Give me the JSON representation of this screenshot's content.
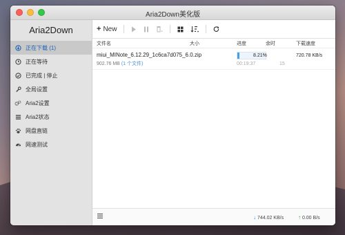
{
  "window": {
    "title": "Aria2Down美化版"
  },
  "sidebar": {
    "brand": "Aria2Down",
    "items": [
      {
        "label": "正在下载 (1)",
        "icon": "download-circle-icon",
        "active": true
      },
      {
        "label": "正在等待",
        "icon": "clock-icon"
      },
      {
        "label": "已完成 | 停止",
        "icon": "check-circle-icon"
      },
      {
        "label": "全局设置",
        "icon": "wrench-icon"
      },
      {
        "label": "Aria2设置",
        "icon": "gears-icon"
      },
      {
        "label": "Aria2状态",
        "icon": "list-icon"
      },
      {
        "label": "网盘直链",
        "icon": "paw-icon"
      },
      {
        "label": "网速测试",
        "icon": "speedometer-icon"
      }
    ]
  },
  "toolbar": {
    "new_label": "New"
  },
  "columns": {
    "name": "文件名",
    "size": "大小",
    "progress": "进度",
    "remaining": "余时",
    "speed": "下载速度"
  },
  "task": {
    "filename": "miui_MINote_6.12.29_1c6ca7d075_6.0.zip",
    "size": "902.76 MB",
    "files": "(1 个文件)",
    "progress_pct": "8.21%",
    "progress_value": 8.21,
    "elapsed": "00:19:37",
    "remaining": "15",
    "speed": "720.78 KB/s"
  },
  "status": {
    "down_speed": "744.02 KB/s",
    "up_speed": "0.00 B/s"
  },
  "colors": {
    "accent": "#46a0e6",
    "active_nav": "#1a5fb4"
  }
}
